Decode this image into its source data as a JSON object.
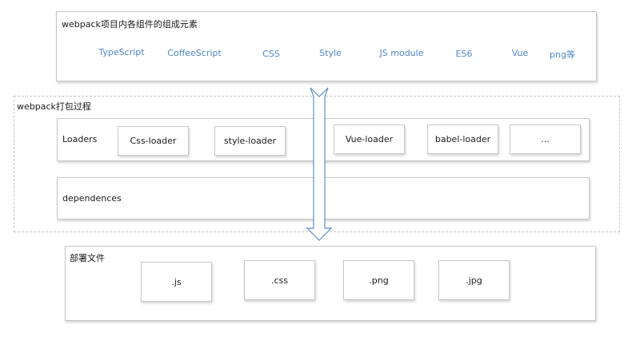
{
  "components": {
    "title": "webpack项目内各组件的组成元素",
    "items": [
      "TypeScript",
      "CoffeeScript",
      "CSS",
      "Style",
      "JS module",
      "ES6",
      "Vue",
      "png等"
    ]
  },
  "process": {
    "title": "webpack打包过程",
    "loaders": {
      "label": "Loaders",
      "items": [
        "Css-loader",
        "style-loader",
        "Vue-loader",
        "babel-loader",
        "..."
      ]
    },
    "dependences": {
      "label": "dependences"
    }
  },
  "deploy": {
    "title": "部署文件",
    "files": [
      ".js",
      ".css",
      ".png",
      ".jpg"
    ]
  },
  "colors": {
    "tech_text": "#4f86c9",
    "arrow_stroke": "#5b8fc9",
    "box_border": "#c8c8c8",
    "dashed_border": "#c4c4c4"
  }
}
